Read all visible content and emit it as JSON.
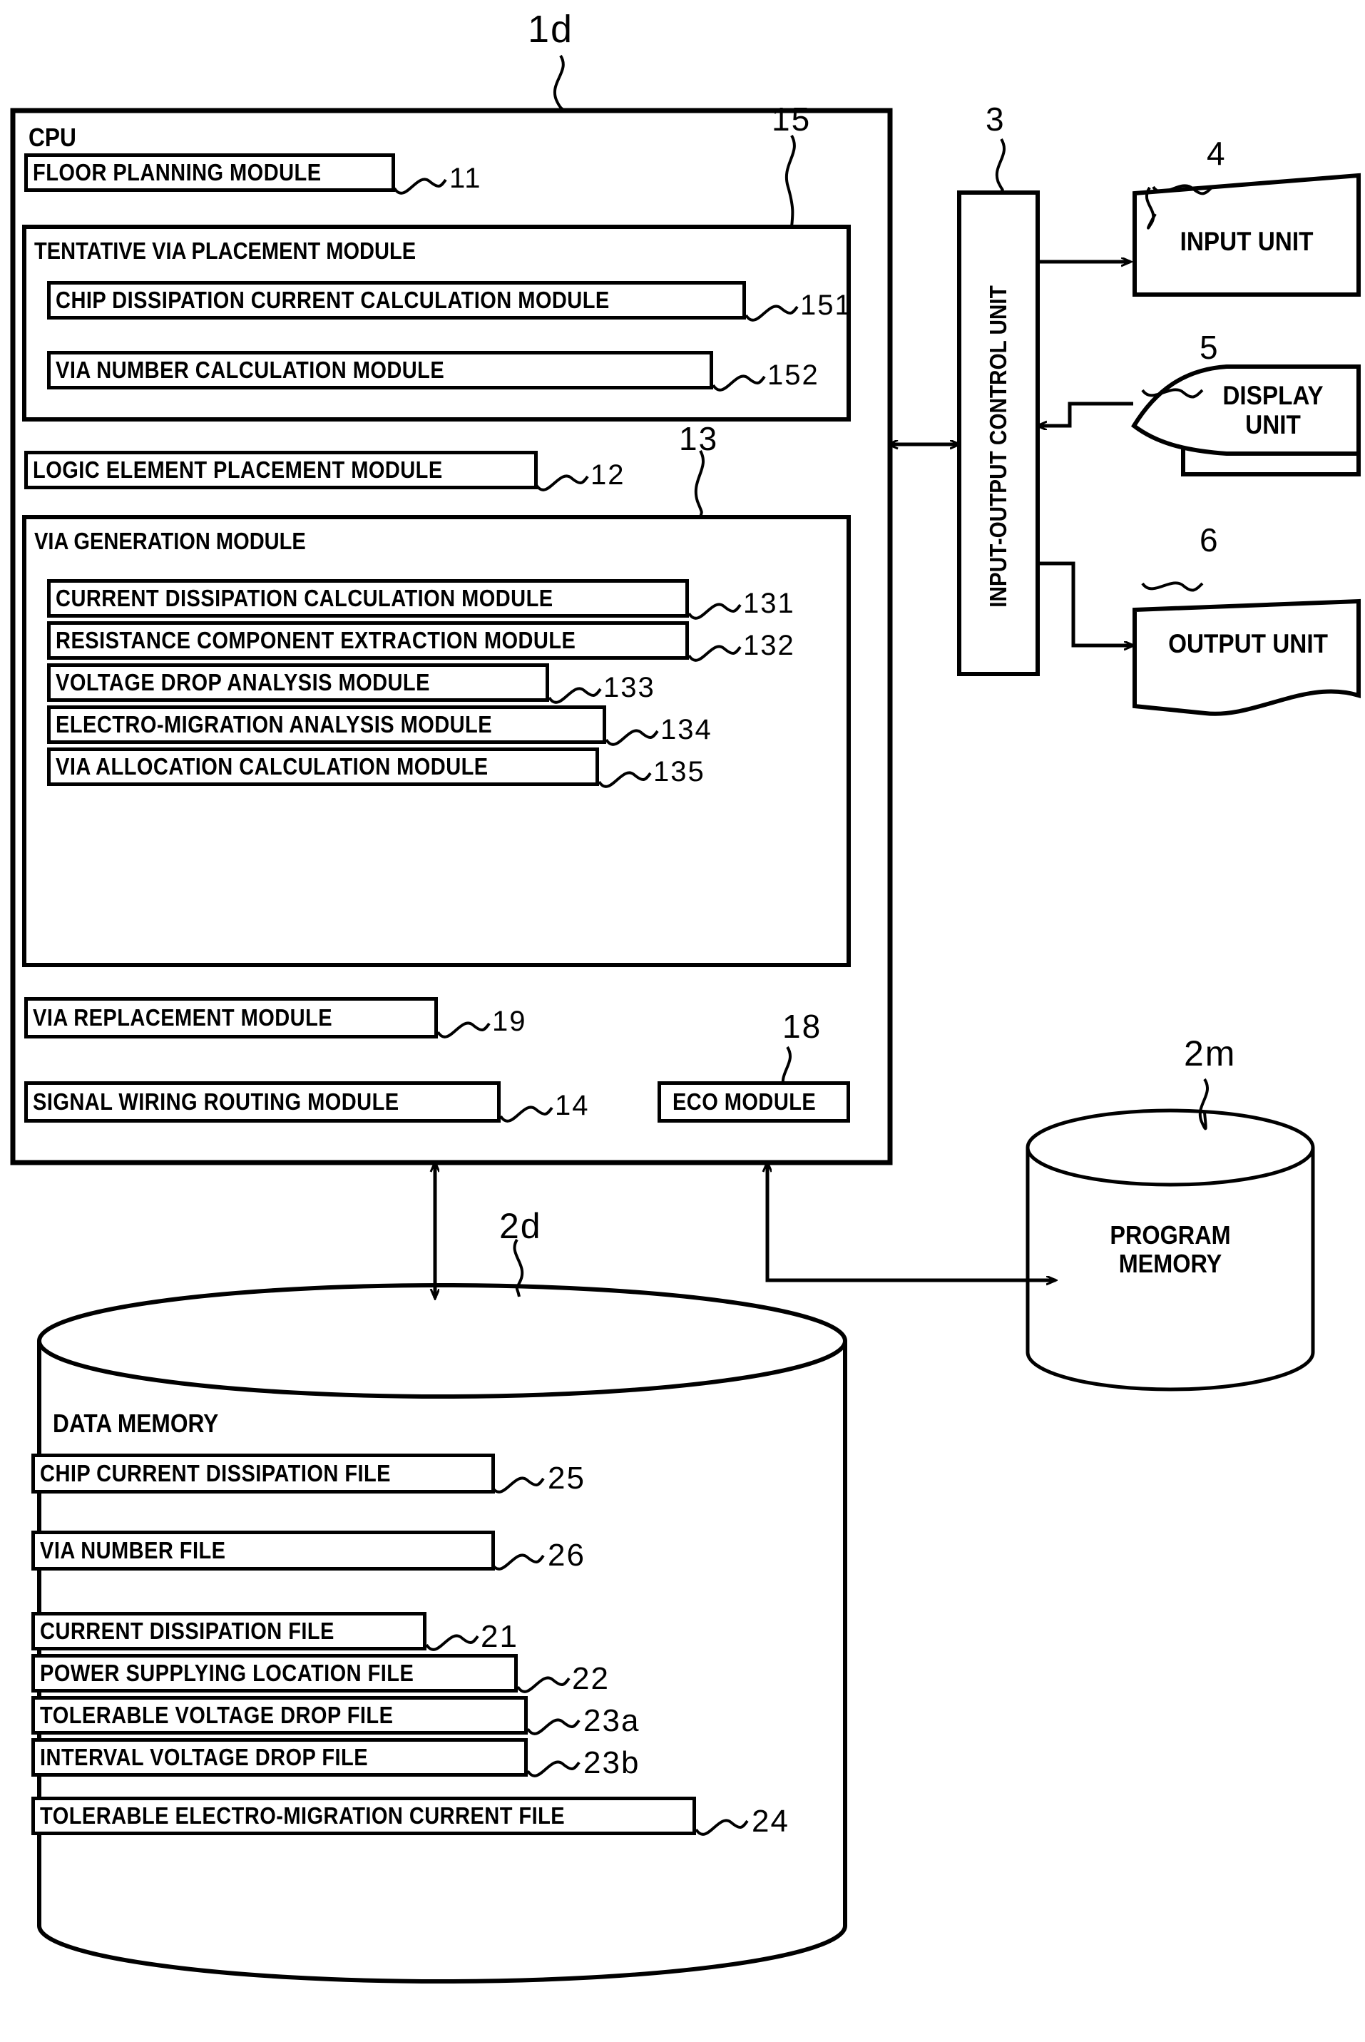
{
  "figure": {
    "system_ref": "1d",
    "cpu": {
      "title": "CPU",
      "modules": [
        {
          "label": "FLOOR PLANNING MODULE",
          "ref": "11"
        },
        {
          "label": "LOGIC ELEMENT PLACEMENT MODULE",
          "ref": "12"
        },
        {
          "label": "VIA REPLACEMENT MODULE",
          "ref": "19"
        },
        {
          "label": "SIGNAL WIRING ROUTING MODULE",
          "ref": "14"
        },
        {
          "label": "ECO MODULE",
          "ref": "18"
        }
      ],
      "tentative_via_placement": {
        "title": "TENTATIVE VIA PLACEMENT MODULE",
        "ref": "15",
        "submodules": [
          {
            "label": "CHIP DISSIPATION CURRENT CALCULATION MODULE",
            "ref": "151"
          },
          {
            "label": "VIA NUMBER CALCULATION MODULE",
            "ref": "152"
          }
        ]
      },
      "via_generation": {
        "title": "VIA GENERATION MODULE",
        "ref": "13",
        "submodules": [
          {
            "label": "CURRENT DISSIPATION CALCULATION MODULE",
            "ref": "131"
          },
          {
            "label": "RESISTANCE COMPONENT EXTRACTION MODULE",
            "ref": "132"
          },
          {
            "label": "VOLTAGE DROP ANALYSIS MODULE",
            "ref": "133"
          },
          {
            "label": "ELECTRO-MIGRATION ANALYSIS MODULE",
            "ref": "134"
          },
          {
            "label": "VIA ALLOCATION CALCULATION MODULE",
            "ref": "135"
          }
        ]
      }
    },
    "io_control_unit": {
      "label": "INPUT-OUTPUT CONTROL UNIT",
      "ref": "3"
    },
    "peripherals": [
      {
        "label": "INPUT UNIT",
        "ref": "4"
      },
      {
        "label": "DISPLAY\nUNIT",
        "ref": "5"
      },
      {
        "label": "OUTPUT UNIT",
        "ref": "6"
      }
    ],
    "program_memory": {
      "label": "PROGRAM\nMEMORY",
      "ref": "2m"
    },
    "data_memory": {
      "title": "DATA MEMORY",
      "ref": "2d",
      "files": [
        {
          "label": "CHIP CURRENT DISSIPATION FILE",
          "ref": "25"
        },
        {
          "label": "VIA NUMBER FILE",
          "ref": "26"
        },
        {
          "label": "CURRENT DISSIPATION  FILE",
          "ref": "21"
        },
        {
          "label": "POWER SUPPLYING LOCATION FILE",
          "ref": "22"
        },
        {
          "label": "TOLERABLE VOLTAGE DROP FILE",
          "ref": "23a"
        },
        {
          "label": "INTERVAL VOLTAGE DROP FILE",
          "ref": "23b"
        },
        {
          "label": "TOLERABLE ELECTRO-MIGRATION CURRENT FILE",
          "ref": "24"
        }
      ]
    },
    "colors": {
      "line": "#000000",
      "background": "#ffffff"
    }
  }
}
